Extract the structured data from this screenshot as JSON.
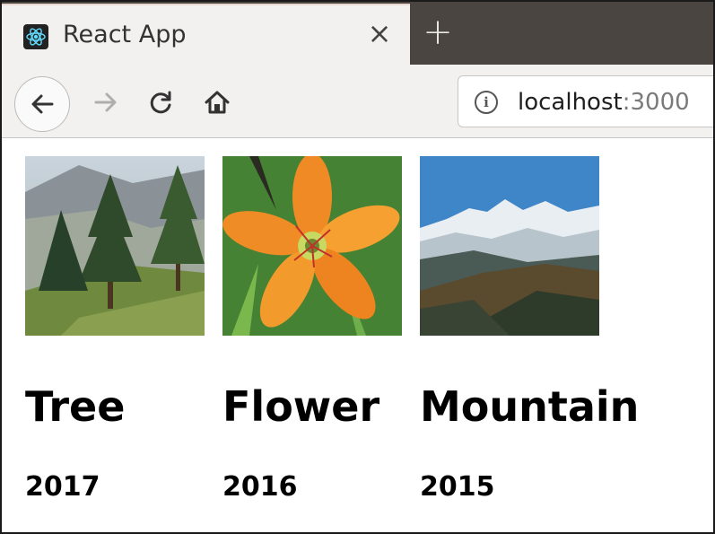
{
  "browser": {
    "tab": {
      "title": "React App",
      "favicon": "react-logo-icon",
      "close_label": "×"
    },
    "new_tab_label": "+",
    "nav": {
      "back_icon": "back-arrow-icon",
      "forward_icon": "forward-arrow-icon",
      "reload_icon": "reload-icon",
      "home_icon": "home-icon"
    },
    "address": {
      "info_label": "i",
      "host": "localhost",
      "port": ":3000"
    }
  },
  "cards": [
    {
      "title": "Tree",
      "year": "2017",
      "image_icon": "tree-photo"
    },
    {
      "title": "Flower",
      "year": "2016",
      "image_icon": "flower-photo"
    },
    {
      "title": "Mountain",
      "year": "2015",
      "image_icon": "mountain-photo"
    }
  ],
  "colors": {
    "tabstrip": "#4a4540",
    "toolbar": "#f2f1f0",
    "text": "#000000"
  }
}
